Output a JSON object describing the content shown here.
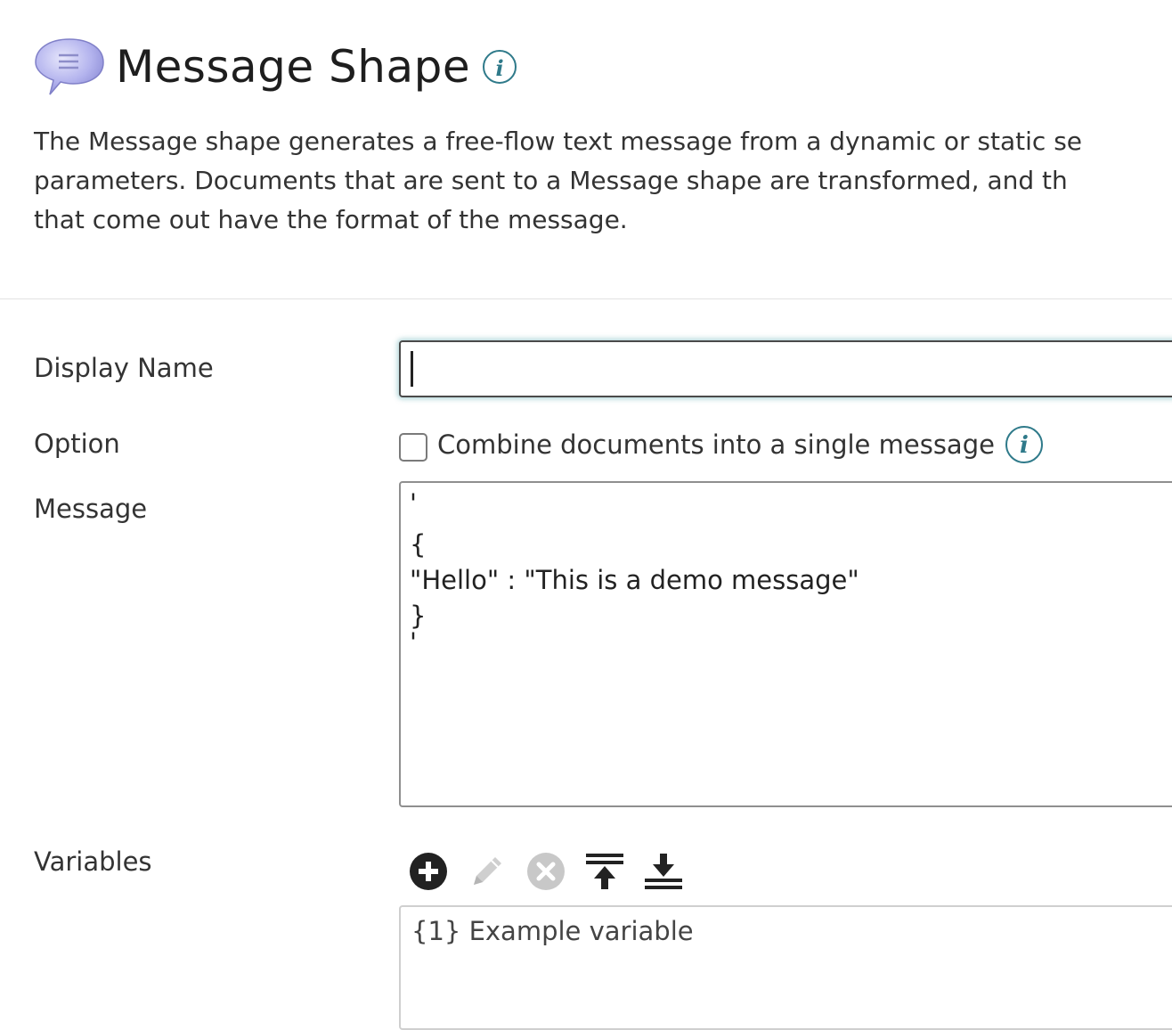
{
  "header": {
    "title": "Message Shape",
    "icon": "speech-bubble-icon",
    "info_icon_text": "i"
  },
  "description": {
    "lines": [
      "The Message shape generates a free-flow text message from a dynamic or static se",
      "parameters. Documents that are sent to a Message shape are transformed, and th",
      "that come out have the format of the message."
    ]
  },
  "form": {
    "display_name": {
      "label": "Display Name",
      "value": ""
    },
    "option": {
      "label": "Option",
      "checkbox_label": "Combine documents into a single message",
      "checked": false,
      "info_icon_text": "i"
    },
    "message": {
      "label": "Message",
      "lines": [
        "'",
        "{",
        "\"Hello\" : \"This is a demo message\"",
        "}",
        "'"
      ]
    },
    "variables": {
      "label": "Variables",
      "toolbar": [
        "add-icon",
        "edit-icon",
        "remove-icon",
        "move-top-icon",
        "move-bottom-icon"
      ],
      "items": [
        "{1} Example variable"
      ]
    }
  },
  "colors": {
    "accent": "#2f7a8a",
    "bubble": "#a8a8e8",
    "icon_dark": "#222222",
    "icon_disabled": "#c8c8c8"
  }
}
